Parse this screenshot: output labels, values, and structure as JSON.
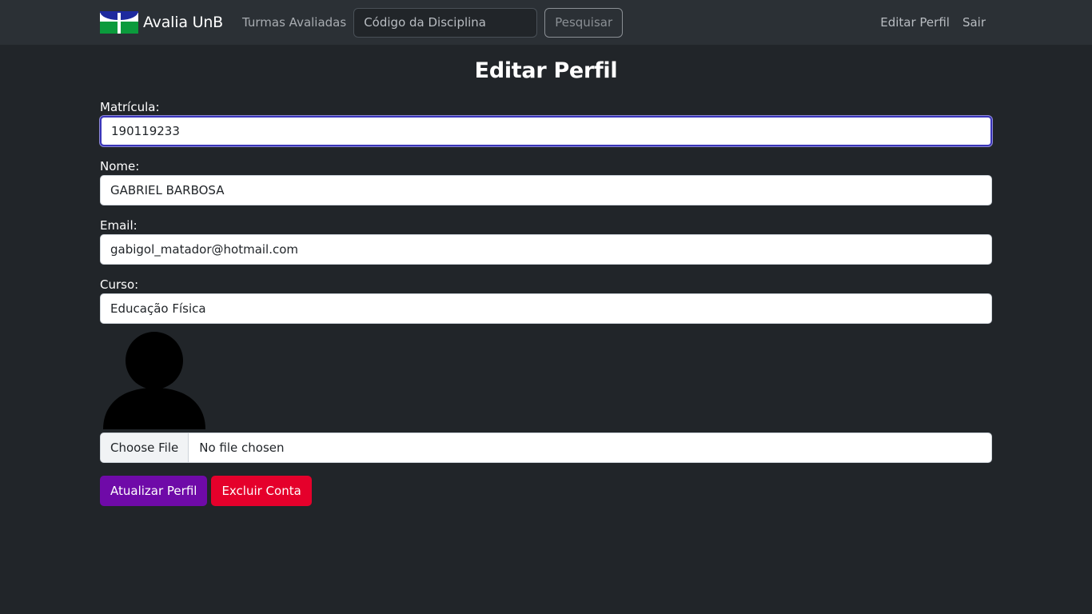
{
  "nav": {
    "brand": "Avalia UnB",
    "turmas_link": "Turmas Avaliadas",
    "search_placeholder": "Código da Disciplina",
    "search_button": "Pesquisar",
    "edit_profile": "Editar Perfil",
    "logout": "Sair"
  },
  "page": {
    "title": "Editar Perfil"
  },
  "form": {
    "matricula": {
      "label": "Matrícula:",
      "value": "190119233"
    },
    "nome": {
      "label": "Nome:",
      "value": "GABRIEL BARBOSA"
    },
    "email": {
      "label": "Email:",
      "value": "gabigol_matador@hotmail.com"
    },
    "curso": {
      "label": "Curso:",
      "value": "Educação Física"
    },
    "file": {
      "button": "Choose File",
      "status": "No file chosen"
    },
    "update_button": "Atualizar Perfil",
    "delete_button": "Excluir Conta"
  },
  "icons": {
    "logo": "unb-logo-icon",
    "avatar": "user-silhouette-icon"
  },
  "colors": {
    "background": "#212529",
    "navbar": "#2b3035",
    "update": "#6f0aa8",
    "delete": "#e5002b",
    "focus_border": "#3a35b8"
  }
}
